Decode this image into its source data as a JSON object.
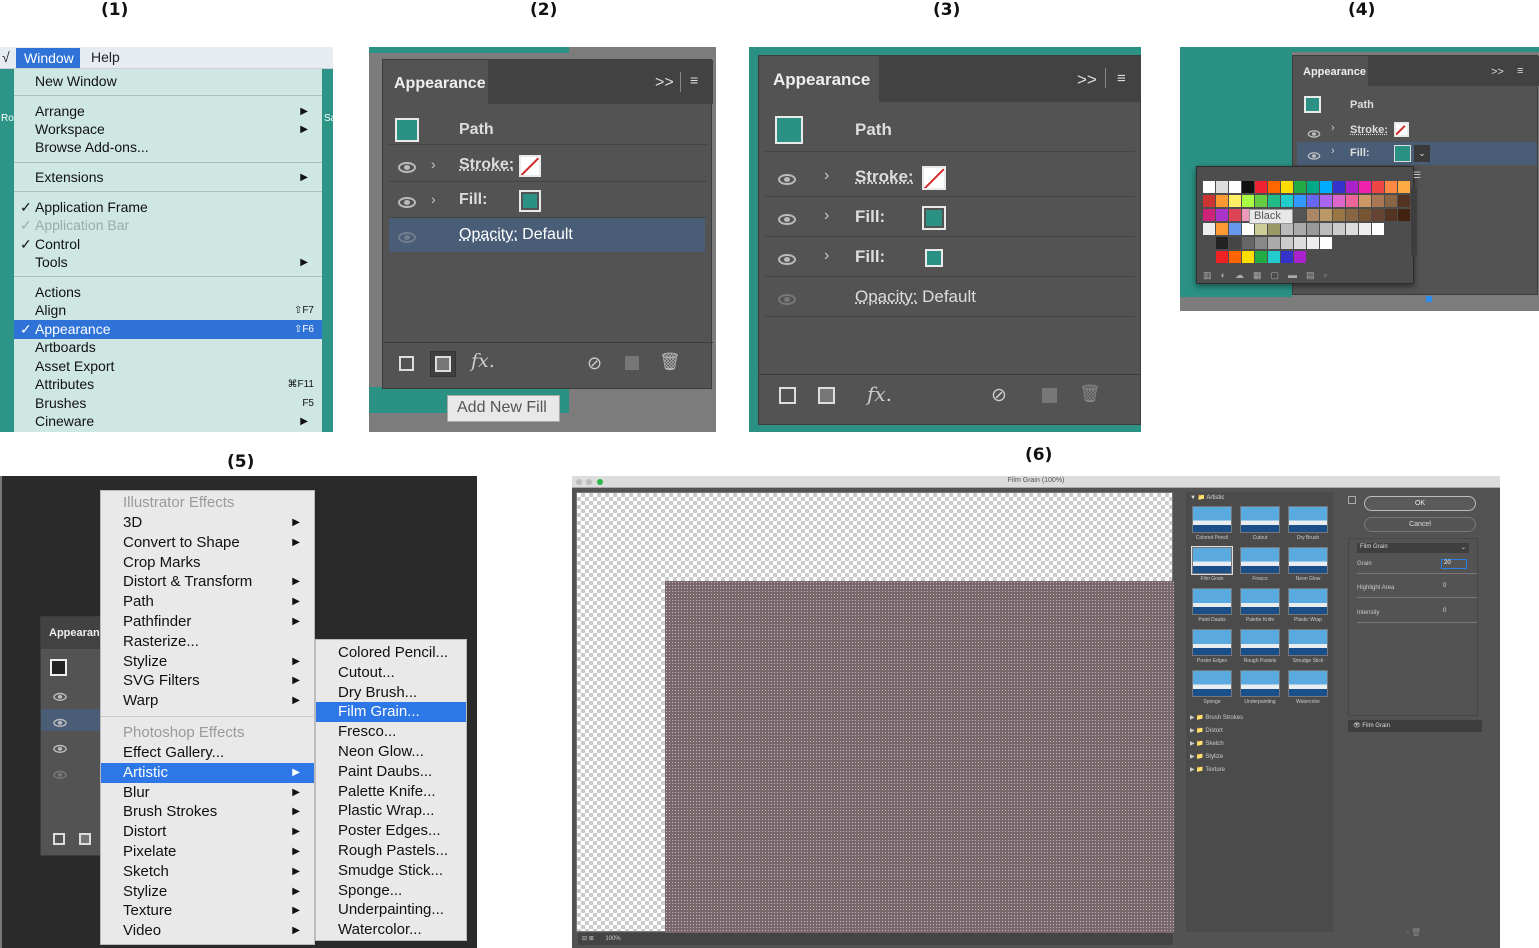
{
  "panel_labels": [
    "(1)",
    "(2)",
    "(3)",
    "(4)",
    "(5)",
    "(6)"
  ],
  "p1": {
    "menubar": {
      "left_fragment": "√",
      "window": "Window",
      "help": "Help",
      "side_left": "Rou",
      "side_right": "Sa"
    },
    "items": {
      "new_window": "New Window",
      "arrange": "Arrange",
      "workspace": "Workspace",
      "browse": "Browse Add-ons...",
      "extensions": "Extensions",
      "app_frame": "Application Frame",
      "app_bar": "Application Bar",
      "control": "Control",
      "tools": "Tools",
      "actions": "Actions",
      "align": "Align",
      "appearance": "Appearance",
      "artboards": "Artboards",
      "asset_export": "Asset Export",
      "attributes": "Attributes",
      "brushes": "Brushes",
      "cineware": "Cineware"
    },
    "shortcuts": {
      "align": "⇧F7",
      "appearance": "⇧F6",
      "attributes": "⌘F11",
      "brushes": "F5"
    },
    "check": "✓"
  },
  "p2": {
    "title": "Appearance",
    "tabs_icon": ">>",
    "path": "Path",
    "stroke": "Stroke:",
    "fill": "Fill:",
    "opacity": "Opacity:",
    "opacity_val": "Default",
    "fx": "fx.",
    "tooltip": "Add New Fill"
  },
  "p3": {
    "title": "Appearance",
    "tabs_icon": ">>",
    "path": "Path",
    "stroke": "Stroke:",
    "fill1": "Fill:",
    "fill2": "Fill:",
    "opacity": "Opacity:",
    "opacity_val": "Default",
    "fx": "fx."
  },
  "p4": {
    "title": "Appearance",
    "tabs_icon": ">>",
    "path": "Path",
    "stroke": "Stroke:",
    "fill": "Fill:",
    "tooltip": "Black"
  },
  "p5": {
    "panel_title": "Appearan",
    "illustrator_header": "Illustrator Effects",
    "illustrator_items": [
      "3D",
      "Convert to Shape",
      "Crop Marks",
      "Distort & Transform",
      "Path",
      "Pathfinder",
      "Rasterize...",
      "Stylize",
      "SVG Filters",
      "Warp"
    ],
    "photoshop_header": "Photoshop Effects",
    "photoshop_items": [
      "Effect Gallery...",
      "Artistic",
      "Blur",
      "Brush Strokes",
      "Distort",
      "Pixelate",
      "Sketch",
      "Stylize",
      "Texture",
      "Video"
    ],
    "artistic_items": [
      "Colored Pencil...",
      "Cutout...",
      "Dry Brush...",
      "Film Grain...",
      "Fresco...",
      "Neon Glow...",
      "Paint Daubs...",
      "Palette Knife...",
      "Plastic Wrap...",
      "Poster Edges...",
      "Rough Pastels...",
      "Smudge Stick...",
      "Sponge...",
      "Underpainting...",
      "Watercolor..."
    ]
  },
  "p6": {
    "title": "Film Grain (100%)",
    "folder": "Artistic",
    "thumbs": [
      "Colored Pencil",
      "Cutout",
      "Dry Brush",
      "Film Grain",
      "Fresco",
      "Neon Glow",
      "Paint Daubs",
      "Palette Knife",
      "Plastic Wrap",
      "Poster Edges",
      "Rough Pastels",
      "Smudge Stick",
      "Sponge",
      "Underpainting",
      "Watercolor"
    ],
    "folders": [
      "Brush Strokes",
      "Distort",
      "Sketch",
      "Stylize",
      "Texture"
    ],
    "ok": "OK",
    "cancel": "Cancel",
    "filter_select": "Film Grain",
    "grain_label": "Grain",
    "grain_val": "20",
    "highlight_label": "Highlight Area",
    "highlight_val": "0",
    "intensity_label": "Intensity",
    "intensity_val": "0",
    "layer": "Film Grain",
    "zoom": "100%"
  }
}
